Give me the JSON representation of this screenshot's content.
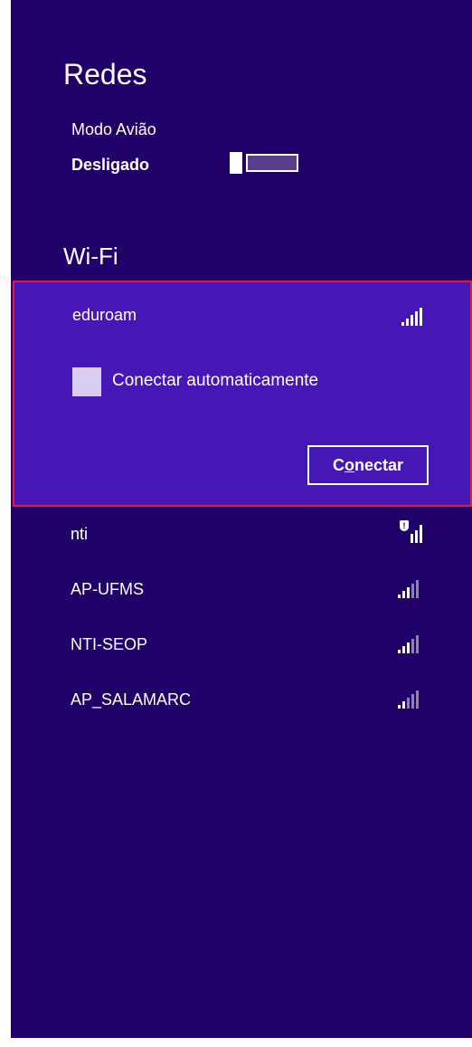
{
  "panel": {
    "title": "Redes"
  },
  "airplane": {
    "label": "Modo Avião",
    "state": "Desligado"
  },
  "wifi": {
    "section_title": "Wi-Fi",
    "selected": {
      "ssid": "eduroam",
      "auto_connect_label": "Conectar automaticamente",
      "connect_button": {
        "underlined": "C",
        "underlined_mid": "o",
        "rest": "nectar"
      }
    },
    "networks": [
      {
        "ssid": "nti",
        "secured_warning": "!"
      },
      {
        "ssid": "AP-UFMS"
      },
      {
        "ssid": "NTI-SEOP"
      },
      {
        "ssid": "AP_SALAMARC"
      }
    ]
  },
  "colors": {
    "background": "#1f0068",
    "selected_bg": "#4617b4",
    "highlight_border": "#e2193a"
  }
}
